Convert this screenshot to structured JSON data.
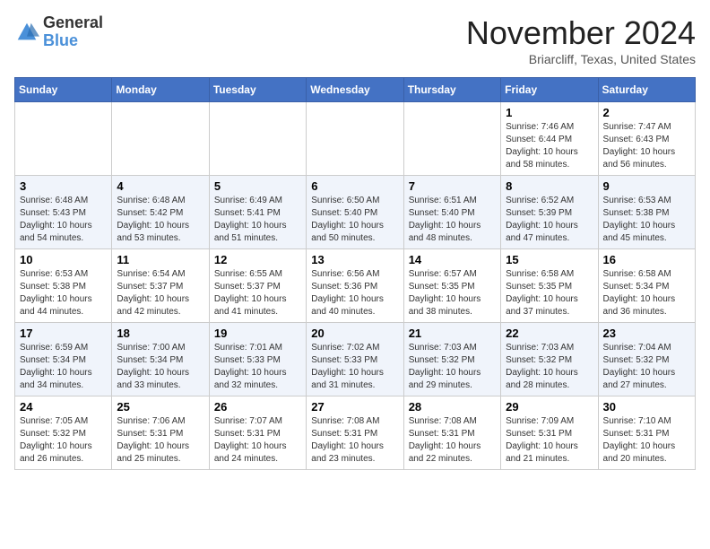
{
  "logo": {
    "line1": "General",
    "line2": "Blue"
  },
  "title": "November 2024",
  "location": "Briarcliff, Texas, United States",
  "weekdays": [
    "Sunday",
    "Monday",
    "Tuesday",
    "Wednesday",
    "Thursday",
    "Friday",
    "Saturday"
  ],
  "weeks": [
    [
      {
        "day": "",
        "info": ""
      },
      {
        "day": "",
        "info": ""
      },
      {
        "day": "",
        "info": ""
      },
      {
        "day": "",
        "info": ""
      },
      {
        "day": "",
        "info": ""
      },
      {
        "day": "1",
        "info": "Sunrise: 7:46 AM\nSunset: 6:44 PM\nDaylight: 10 hours\nand 58 minutes."
      },
      {
        "day": "2",
        "info": "Sunrise: 7:47 AM\nSunset: 6:43 PM\nDaylight: 10 hours\nand 56 minutes."
      }
    ],
    [
      {
        "day": "3",
        "info": "Sunrise: 6:48 AM\nSunset: 5:43 PM\nDaylight: 10 hours\nand 54 minutes."
      },
      {
        "day": "4",
        "info": "Sunrise: 6:48 AM\nSunset: 5:42 PM\nDaylight: 10 hours\nand 53 minutes."
      },
      {
        "day": "5",
        "info": "Sunrise: 6:49 AM\nSunset: 5:41 PM\nDaylight: 10 hours\nand 51 minutes."
      },
      {
        "day": "6",
        "info": "Sunrise: 6:50 AM\nSunset: 5:40 PM\nDaylight: 10 hours\nand 50 minutes."
      },
      {
        "day": "7",
        "info": "Sunrise: 6:51 AM\nSunset: 5:40 PM\nDaylight: 10 hours\nand 48 minutes."
      },
      {
        "day": "8",
        "info": "Sunrise: 6:52 AM\nSunset: 5:39 PM\nDaylight: 10 hours\nand 47 minutes."
      },
      {
        "day": "9",
        "info": "Sunrise: 6:53 AM\nSunset: 5:38 PM\nDaylight: 10 hours\nand 45 minutes."
      }
    ],
    [
      {
        "day": "10",
        "info": "Sunrise: 6:53 AM\nSunset: 5:38 PM\nDaylight: 10 hours\nand 44 minutes."
      },
      {
        "day": "11",
        "info": "Sunrise: 6:54 AM\nSunset: 5:37 PM\nDaylight: 10 hours\nand 42 minutes."
      },
      {
        "day": "12",
        "info": "Sunrise: 6:55 AM\nSunset: 5:37 PM\nDaylight: 10 hours\nand 41 minutes."
      },
      {
        "day": "13",
        "info": "Sunrise: 6:56 AM\nSunset: 5:36 PM\nDaylight: 10 hours\nand 40 minutes."
      },
      {
        "day": "14",
        "info": "Sunrise: 6:57 AM\nSunset: 5:35 PM\nDaylight: 10 hours\nand 38 minutes."
      },
      {
        "day": "15",
        "info": "Sunrise: 6:58 AM\nSunset: 5:35 PM\nDaylight: 10 hours\nand 37 minutes."
      },
      {
        "day": "16",
        "info": "Sunrise: 6:58 AM\nSunset: 5:34 PM\nDaylight: 10 hours\nand 36 minutes."
      }
    ],
    [
      {
        "day": "17",
        "info": "Sunrise: 6:59 AM\nSunset: 5:34 PM\nDaylight: 10 hours\nand 34 minutes."
      },
      {
        "day": "18",
        "info": "Sunrise: 7:00 AM\nSunset: 5:34 PM\nDaylight: 10 hours\nand 33 minutes."
      },
      {
        "day": "19",
        "info": "Sunrise: 7:01 AM\nSunset: 5:33 PM\nDaylight: 10 hours\nand 32 minutes."
      },
      {
        "day": "20",
        "info": "Sunrise: 7:02 AM\nSunset: 5:33 PM\nDaylight: 10 hours\nand 31 minutes."
      },
      {
        "day": "21",
        "info": "Sunrise: 7:03 AM\nSunset: 5:32 PM\nDaylight: 10 hours\nand 29 minutes."
      },
      {
        "day": "22",
        "info": "Sunrise: 7:03 AM\nSunset: 5:32 PM\nDaylight: 10 hours\nand 28 minutes."
      },
      {
        "day": "23",
        "info": "Sunrise: 7:04 AM\nSunset: 5:32 PM\nDaylight: 10 hours\nand 27 minutes."
      }
    ],
    [
      {
        "day": "24",
        "info": "Sunrise: 7:05 AM\nSunset: 5:32 PM\nDaylight: 10 hours\nand 26 minutes."
      },
      {
        "day": "25",
        "info": "Sunrise: 7:06 AM\nSunset: 5:31 PM\nDaylight: 10 hours\nand 25 minutes."
      },
      {
        "day": "26",
        "info": "Sunrise: 7:07 AM\nSunset: 5:31 PM\nDaylight: 10 hours\nand 24 minutes."
      },
      {
        "day": "27",
        "info": "Sunrise: 7:08 AM\nSunset: 5:31 PM\nDaylight: 10 hours\nand 23 minutes."
      },
      {
        "day": "28",
        "info": "Sunrise: 7:08 AM\nSunset: 5:31 PM\nDaylight: 10 hours\nand 22 minutes."
      },
      {
        "day": "29",
        "info": "Sunrise: 7:09 AM\nSunset: 5:31 PM\nDaylight: 10 hours\nand 21 minutes."
      },
      {
        "day": "30",
        "info": "Sunrise: 7:10 AM\nSunset: 5:31 PM\nDaylight: 10 hours\nand 20 minutes."
      }
    ]
  ]
}
